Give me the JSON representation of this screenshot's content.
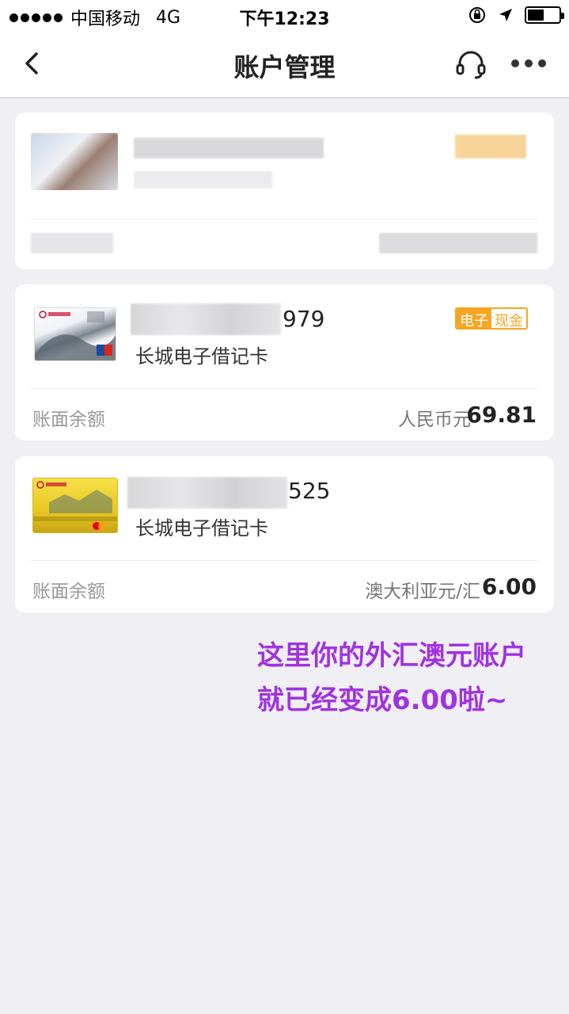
{
  "status_bar": {
    "carrier": "中国移动",
    "network": "4G",
    "time": "下午12:23"
  },
  "nav": {
    "title": "账户管理"
  },
  "accounts": [
    {
      "number_suffix": "",
      "card_type": "",
      "balance_label": "",
      "currency": "",
      "amount": "",
      "blurred": true
    },
    {
      "number_suffix": "979",
      "card_type": "长城电子借记卡",
      "tag_left": "电子",
      "tag_right": "现金",
      "balance_label": "账面余额",
      "currency": "人民币元",
      "amount": "69.81"
    },
    {
      "number_suffix": "525",
      "card_type": "长城电子借记卡",
      "balance_label": "账面余额",
      "currency": "澳大利亚元/汇",
      "amount": "6.00"
    }
  ],
  "annotation": {
    "line1": "这里你的外汇澳元账户",
    "line2": "就已经变成6.00啦~"
  },
  "colors": {
    "accent": "#f5a623",
    "annotation": "#a033e0",
    "background": "#efeff4"
  }
}
